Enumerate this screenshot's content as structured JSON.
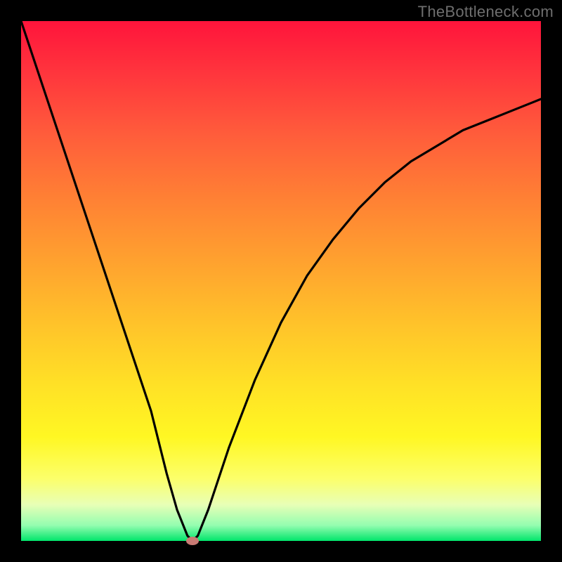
{
  "watermark": "TheBottleneck.com",
  "chart_data": {
    "type": "line",
    "title": "",
    "xlabel": "",
    "ylabel": "",
    "xlim": [
      0,
      100
    ],
    "ylim": [
      0,
      100
    ],
    "background": "red-yellow-green vertical gradient",
    "series": [
      {
        "name": "bottleneck-curve",
        "x": [
          0,
          5,
          10,
          15,
          20,
          25,
          28,
          30,
          32,
          33,
          34,
          36,
          40,
          45,
          50,
          55,
          60,
          65,
          70,
          75,
          80,
          85,
          90,
          95,
          100
        ],
        "values": [
          100,
          85,
          70,
          55,
          40,
          25,
          13,
          6,
          1,
          0,
          1,
          6,
          18,
          31,
          42,
          51,
          58,
          64,
          69,
          73,
          76,
          79,
          81,
          83,
          85
        ]
      }
    ],
    "marker": {
      "x": 33,
      "y": 0,
      "color": "#c97b74"
    },
    "grid": false,
    "legend": false
  }
}
